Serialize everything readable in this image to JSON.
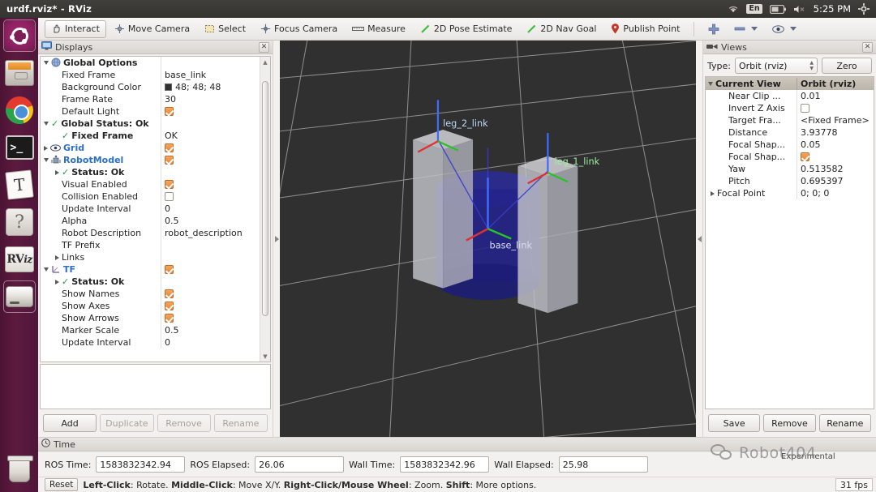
{
  "desktop": {
    "window_title": "urdf.rviz* - RViz",
    "tray": {
      "wifi_icon": "wifi-icon",
      "keyboard_layout": "En",
      "battery_icon": "battery-icon",
      "volume_icon": "volume-muted-icon",
      "clock": "5:25 PM",
      "settings_icon": "gear-icon"
    },
    "launcher": [
      {
        "name": "ubuntu-dash",
        "label": "Ubuntu Dash",
        "icon": "ubuntu-icon"
      },
      {
        "name": "files",
        "label": "Files",
        "icon": "file-manager-icon"
      },
      {
        "name": "chrome",
        "label": "Google Chrome",
        "icon": "chrome-icon"
      },
      {
        "name": "terminal",
        "label": "Terminal",
        "icon": "terminal-icon"
      },
      {
        "name": "text-editor",
        "label": "Text Editor",
        "icon": "text-editor-icon"
      },
      {
        "name": "help",
        "label": "Help",
        "icon": "help-icon"
      },
      {
        "name": "rviz",
        "label": "RViz",
        "icon": "rviz-icon"
      },
      {
        "name": "drive",
        "label": "Disk",
        "icon": "drive-icon"
      },
      {
        "name": "trash",
        "label": "Trash",
        "icon": "trash-icon"
      }
    ]
  },
  "toolbar": {
    "items": [
      {
        "label": "Interact",
        "icon": "hand-cursor-icon",
        "active": true
      },
      {
        "label": "Move Camera",
        "icon": "move-camera-icon",
        "active": false
      },
      {
        "label": "Select",
        "icon": "select-rectangle-icon",
        "active": false
      },
      {
        "label": "Focus Camera",
        "icon": "focus-camera-icon",
        "active": false
      },
      {
        "label": "Measure",
        "icon": "ruler-icon",
        "active": false
      },
      {
        "label": "2D Pose Estimate",
        "icon": "pose-arrow-icon",
        "active": false
      },
      {
        "label": "2D Nav Goal",
        "icon": "nav-goal-arrow-icon",
        "active": false
      },
      {
        "label": "Publish Point",
        "icon": "map-pin-icon",
        "active": false
      }
    ],
    "extras": [
      {
        "name": "add-tool-button",
        "icon": "plus-icon"
      },
      {
        "name": "remove-tool-dropdown",
        "icon": "minus-icon"
      },
      {
        "name": "visibility-dropdown",
        "icon": "eye-icon"
      }
    ]
  },
  "displays": {
    "title": "Displays",
    "close_icon": "close-icon",
    "rows": [
      {
        "indent": 0,
        "arrow": "down",
        "icon": "globe-icon",
        "name": "Global Options",
        "style": "bold",
        "value_type": "none",
        "value": ""
      },
      {
        "indent": 1,
        "arrow": "none",
        "icon": "",
        "name": "Fixed Frame",
        "style": "plain",
        "value_type": "text",
        "value": "base_link"
      },
      {
        "indent": 1,
        "arrow": "none",
        "icon": "",
        "name": "Background Color",
        "style": "plain",
        "value_type": "color",
        "value": "48; 48; 48",
        "color": "#303030"
      },
      {
        "indent": 1,
        "arrow": "none",
        "icon": "",
        "name": "Frame Rate",
        "style": "plain",
        "value_type": "text",
        "value": "30"
      },
      {
        "indent": 1,
        "arrow": "none",
        "icon": "",
        "name": "Default Light",
        "style": "plain",
        "value_type": "check",
        "checked": true
      },
      {
        "indent": 0,
        "arrow": "down",
        "icon": "ok-check-icon",
        "name": "Global Status: Ok",
        "style": "bold",
        "value_type": "none",
        "value": ""
      },
      {
        "indent": 1,
        "arrow": "none",
        "icon": "ok-check-icon",
        "name": "Fixed Frame",
        "style": "bold",
        "value_type": "text",
        "value": "OK"
      },
      {
        "indent": 0,
        "arrow": "right",
        "icon": "eye-icon",
        "name": "Grid",
        "style": "link",
        "value_type": "check",
        "checked": true
      },
      {
        "indent": 0,
        "arrow": "down",
        "icon": "robot-icon",
        "name": "RobotModel",
        "style": "link",
        "value_type": "check",
        "checked": true
      },
      {
        "indent": 1,
        "arrow": "right",
        "icon": "ok-check-icon",
        "name": "Status: Ok",
        "style": "bold",
        "value_type": "none",
        "value": ""
      },
      {
        "indent": 1,
        "arrow": "none",
        "icon": "",
        "name": "Visual Enabled",
        "style": "plain",
        "value_type": "check",
        "checked": true
      },
      {
        "indent": 1,
        "arrow": "none",
        "icon": "",
        "name": "Collision Enabled",
        "style": "plain",
        "value_type": "check",
        "checked": false
      },
      {
        "indent": 1,
        "arrow": "none",
        "icon": "",
        "name": "Update Interval",
        "style": "plain",
        "value_type": "text",
        "value": "0"
      },
      {
        "indent": 1,
        "arrow": "none",
        "icon": "",
        "name": "Alpha",
        "style": "plain",
        "value_type": "text",
        "value": "0.5"
      },
      {
        "indent": 1,
        "arrow": "none",
        "icon": "",
        "name": "Robot Description",
        "style": "plain",
        "value_type": "text",
        "value": "robot_description"
      },
      {
        "indent": 1,
        "arrow": "none",
        "icon": "",
        "name": "TF Prefix",
        "style": "plain",
        "value_type": "text",
        "value": ""
      },
      {
        "indent": 1,
        "arrow": "right",
        "icon": "",
        "name": "Links",
        "style": "plain",
        "value_type": "none",
        "value": ""
      },
      {
        "indent": 0,
        "arrow": "down",
        "icon": "tf-icon",
        "name": "TF",
        "style": "link",
        "value_type": "check",
        "checked": true
      },
      {
        "indent": 1,
        "arrow": "right",
        "icon": "ok-check-icon",
        "name": "Status: Ok",
        "style": "bold",
        "value_type": "none",
        "value": ""
      },
      {
        "indent": 1,
        "arrow": "none",
        "icon": "",
        "name": "Show Names",
        "style": "plain",
        "value_type": "check",
        "checked": true
      },
      {
        "indent": 1,
        "arrow": "none",
        "icon": "",
        "name": "Show Axes",
        "style": "plain",
        "value_type": "check",
        "checked": true
      },
      {
        "indent": 1,
        "arrow": "none",
        "icon": "",
        "name": "Show Arrows",
        "style": "plain",
        "value_type": "check",
        "checked": true
      },
      {
        "indent": 1,
        "arrow": "none",
        "icon": "",
        "name": "Marker Scale",
        "style": "plain",
        "value_type": "text",
        "value": "0.5"
      },
      {
        "indent": 1,
        "arrow": "none",
        "icon": "",
        "name": "Update Interval",
        "style": "plain",
        "value_type": "text",
        "value": "0"
      }
    ],
    "buttons": [
      {
        "label": "Add",
        "enabled": true
      },
      {
        "label": "Duplicate",
        "enabled": false
      },
      {
        "label": "Remove",
        "enabled": false
      },
      {
        "label": "Rename",
        "enabled": false
      }
    ]
  },
  "views": {
    "title": "Views",
    "close_icon": "close-icon",
    "type_label": "Type:",
    "type_value": "Orbit (rviz)",
    "zero_label": "Zero",
    "header": {
      "name": "Current View",
      "value": "Orbit (rviz)"
    },
    "rows": [
      {
        "indent": 1,
        "arrow": "none",
        "name": "Near Clip ...",
        "value_type": "text",
        "value": "0.01"
      },
      {
        "indent": 1,
        "arrow": "none",
        "name": "Invert Z Axis",
        "value_type": "check",
        "checked": false
      },
      {
        "indent": 1,
        "arrow": "none",
        "name": "Target Fra...",
        "value_type": "text",
        "value": "<Fixed Frame>"
      },
      {
        "indent": 1,
        "arrow": "none",
        "name": "Distance",
        "value_type": "text",
        "value": "3.93778"
      },
      {
        "indent": 1,
        "arrow": "none",
        "name": "Focal Shap...",
        "value_type": "text",
        "value": "0.05"
      },
      {
        "indent": 1,
        "arrow": "none",
        "name": "Focal Shap...",
        "value_type": "check",
        "checked": true
      },
      {
        "indent": 1,
        "arrow": "none",
        "name": "Yaw",
        "value_type": "text",
        "value": "0.513582"
      },
      {
        "indent": 1,
        "arrow": "none",
        "name": "Pitch",
        "value_type": "text",
        "value": "0.695397"
      },
      {
        "indent": 0,
        "arrow": "right",
        "name": "Focal Point",
        "value_type": "text",
        "value": "0; 0; 0"
      }
    ],
    "buttons": [
      {
        "label": "Save",
        "enabled": true
      },
      {
        "label": "Remove",
        "enabled": true
      },
      {
        "label": "Rename",
        "enabled": true
      }
    ]
  },
  "viewport": {
    "background_color": "#303030",
    "grid_color": "#9a9a9a",
    "robot": {
      "body_color": "#2a2a8c",
      "leg_color": "#c9c9cf",
      "frames": [
        {
          "name": "base_link"
        },
        {
          "name": "leg_2_link"
        },
        {
          "name": "leg_1_link"
        }
      ]
    }
  },
  "time": {
    "title": "Time",
    "clock_icon": "clock-icon",
    "fields": [
      {
        "label": "ROS Time:",
        "value": "1583832342.94"
      },
      {
        "label": "ROS Elapsed:",
        "value": "26.06"
      },
      {
        "label": "Wall Time:",
        "value": "1583832342.96"
      },
      {
        "label": "Wall Elapsed:",
        "value": "25.98"
      }
    ]
  },
  "status": {
    "reset_label": "Reset",
    "hint_parts": [
      {
        "text": "Left-Click",
        "bold": true
      },
      {
        "text": ": Rotate.  ",
        "bold": false
      },
      {
        "text": "Middle-Click",
        "bold": true
      },
      {
        "text": ": Move X/Y.  ",
        "bold": false
      },
      {
        "text": "Right-Click/Mouse Wheel",
        "bold": true
      },
      {
        "text": ": Zoom.  ",
        "bold": false
      },
      {
        "text": "Shift",
        "bold": true
      },
      {
        "text": ": More options.",
        "bold": false
      }
    ],
    "fps": "31 fps",
    "experimental_label": "Experimental"
  },
  "watermark": {
    "text": "Robot404",
    "icon": "wechat-icon"
  }
}
